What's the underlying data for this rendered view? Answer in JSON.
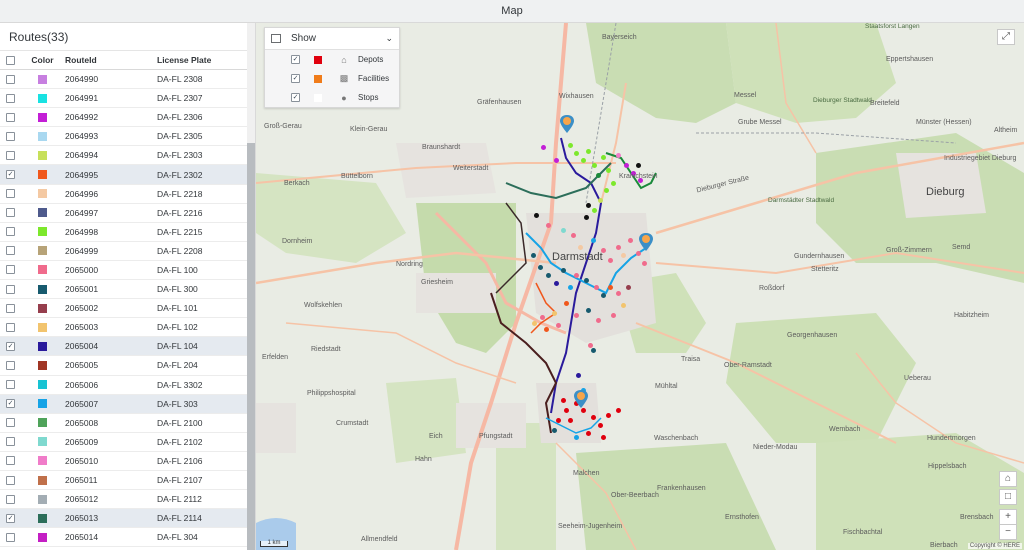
{
  "titlebar": {
    "title": "Map"
  },
  "routes_panel": {
    "title": "Routes(33)",
    "columns": {
      "color": "Color",
      "route_id": "RouteId",
      "plate": "License Plate"
    },
    "rows": [
      {
        "id": "2064990",
        "plate": "DA-FL 2308",
        "color": "#c77fe0",
        "checked": false
      },
      {
        "id": "2064991",
        "plate": "DA-FL 2307",
        "color": "#19e2e2",
        "checked": false
      },
      {
        "id": "2064992",
        "plate": "DA-FL 2306",
        "color": "#c31fd6",
        "checked": false
      },
      {
        "id": "2064993",
        "plate": "DA-FL 2305",
        "color": "#a9d8f0",
        "checked": false
      },
      {
        "id": "2064994",
        "plate": "DA-FL 2303",
        "color": "#c7e05a",
        "checked": false
      },
      {
        "id": "2064995",
        "plate": "DA-FL 2302",
        "color": "#f0571c",
        "checked": true
      },
      {
        "id": "2064996",
        "plate": "DA-FL 2218",
        "color": "#f4c9a3",
        "checked": false
      },
      {
        "id": "2064997",
        "plate": "DA-FL 2216",
        "color": "#4e5a8c",
        "checked": false
      },
      {
        "id": "2064998",
        "plate": "DA-FL 2215",
        "color": "#7de82c",
        "checked": false
      },
      {
        "id": "2064999",
        "plate": "DA-FL 2208",
        "color": "#b7a378",
        "checked": false
      },
      {
        "id": "2065000",
        "plate": "DA-FL 100",
        "color": "#f06b8c",
        "checked": false
      },
      {
        "id": "2065001",
        "plate": "DA-FL 300",
        "color": "#175a6e",
        "checked": false
      },
      {
        "id": "2065002",
        "plate": "DA-FL 101",
        "color": "#963e4d",
        "checked": false
      },
      {
        "id": "2065003",
        "plate": "DA-FL 102",
        "color": "#f2c46e",
        "checked": false
      },
      {
        "id": "2065004",
        "plate": "DA-FL 104",
        "color": "#2a1a9c",
        "checked": true
      },
      {
        "id": "2065005",
        "plate": "DA-FL 204",
        "color": "#a03524",
        "checked": false
      },
      {
        "id": "2065006",
        "plate": "DA-FL 3302",
        "color": "#17c3d3",
        "checked": false
      },
      {
        "id": "2065007",
        "plate": "DA-FL 303",
        "color": "#16a3e6",
        "checked": true
      },
      {
        "id": "2065008",
        "plate": "DA-FL 2100",
        "color": "#4fa35a",
        "checked": false
      },
      {
        "id": "2065009",
        "plate": "DA-FL 2102",
        "color": "#7fd9cf",
        "checked": false
      },
      {
        "id": "2065010",
        "plate": "DA-FL 2106",
        "color": "#f07cc9",
        "checked": false
      },
      {
        "id": "2065011",
        "plate": "DA-FL 2107",
        "color": "#c0704a",
        "checked": false
      },
      {
        "id": "2065012",
        "plate": "DA-FL 2112",
        "color": "#a3adb4",
        "checked": false
      },
      {
        "id": "2065013",
        "plate": "DA-FL 2114",
        "color": "#2c6e5a",
        "checked": true
      },
      {
        "id": "2065014",
        "plate": "DA-FL 304",
        "color": "#c41fc4",
        "checked": false
      }
    ]
  },
  "legend": {
    "title": "Show",
    "items": [
      {
        "label": "Depots",
        "color": "#e0000e",
        "icon": "house-icon"
      },
      {
        "label": "Facilities",
        "color": "#f07c1a",
        "icon": "factory-icon"
      },
      {
        "label": "Stops",
        "color": "#ffffff",
        "icon": "circle-icon"
      }
    ]
  },
  "map": {
    "labels": {
      "bayerseich": "Bayerseich",
      "staatsforst_langen": "Staatsforst Langen",
      "eppertshausen": "Eppertshausen",
      "muenster": "Münster (Hessen)",
      "altheim": "Altheim",
      "graefenhausen": "Gräfenhausen",
      "wixhausen": "Wixhausen",
      "messel": "Messel",
      "grube_messel": "Grube Messel",
      "dieburger_stadtwald": "Dieburger Stadtwald",
      "breitefeld": "Breitefeld",
      "industriegebiet": "Industriegebiet Dieburg",
      "gross_gerau": "Groß-Gerau",
      "klein_gerau": "Klein-Gerau",
      "braunshardt": "Braunshardt",
      "weiterstadt": "Weiterstadt",
      "buettelborn": "Büttelborn",
      "kranichstein": "Kranichstein",
      "dieburg": "Dieburg",
      "berkach": "Berkach",
      "darmstaedter_stadtwald": "Darmstädter Stadtwald",
      "dornheim": "Dornheim",
      "darmstadt": "Darmstadt",
      "gundernhausen": "Gundernhausen",
      "semd": "Semd",
      "gross_zimmern": "Groß-Zimmern",
      "wolfskehlen": "Wolfskehlen",
      "griesheim": "Griesheim",
      "rossdorf": "Roßdorf",
      "stetteritz": "Stetteritz",
      "habitzheim": "Habitzheim",
      "georgenhausen": "Georgenhausen",
      "erfelden": "Erfelden",
      "riedstadt": "Riedstadt",
      "ober_ramstadt": "Ober-Ramstadt",
      "muehltal": "Mühltal",
      "traisa": "Traisa",
      "philippshospital": "Philippshospital",
      "ueberau": "Ueberau",
      "crumstadt": "Crumstadt",
      "wembach": "Wembach",
      "pfungstadt": "Pfungstadt",
      "eich": "Eich",
      "waschenbach": "Waschenbach",
      "nieder_modau": "Nieder-Modau",
      "hahn": "Hahn",
      "malchen": "Malchen",
      "hundertmorgen": "Hundertmorgen",
      "hippelsbach": "Hippelsbach",
      "ober_beerbach": "Ober-Beerbach",
      "frankenhausen": "Frankenhausen",
      "seeheim": "Seeheim-Jugenheim",
      "ernsthofen": "Ernsthofen",
      "fischbachtal": "Fischbachtal",
      "brensbach": "Brensbach",
      "allmendfeld": "Allmendfeld",
      "bierbach": "Bierbach",
      "nordring": "Nordring",
      "dieburger_strasse": "Dieburger Straße"
    },
    "scale": "1 km",
    "copyright": "Copyright © HERE"
  }
}
